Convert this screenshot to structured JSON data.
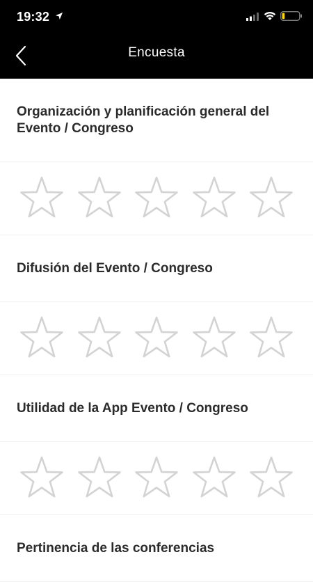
{
  "status_bar": {
    "time": "19:32",
    "icons": [
      "location-arrow-icon",
      "cellular-signal-icon",
      "wifi-icon",
      "battery-low-icon"
    ],
    "battery_color": "#ffd60a"
  },
  "nav": {
    "title": "Encuesta",
    "back_icon": "chevron-left-icon"
  },
  "survey": {
    "questions": [
      {
        "text": "Organización y planificación general del Evento / Congreso",
        "rating": 0,
        "max": 5
      },
      {
        "text": "Difusión del Evento / Congreso",
        "rating": 0,
        "max": 5
      },
      {
        "text": "Utilidad de la App Evento / Congreso",
        "rating": 0,
        "max": 5
      },
      {
        "text": "Pertinencia de las conferencias",
        "rating": 0,
        "max": 5
      }
    ],
    "star_outline_color": "#d3d3d3"
  }
}
